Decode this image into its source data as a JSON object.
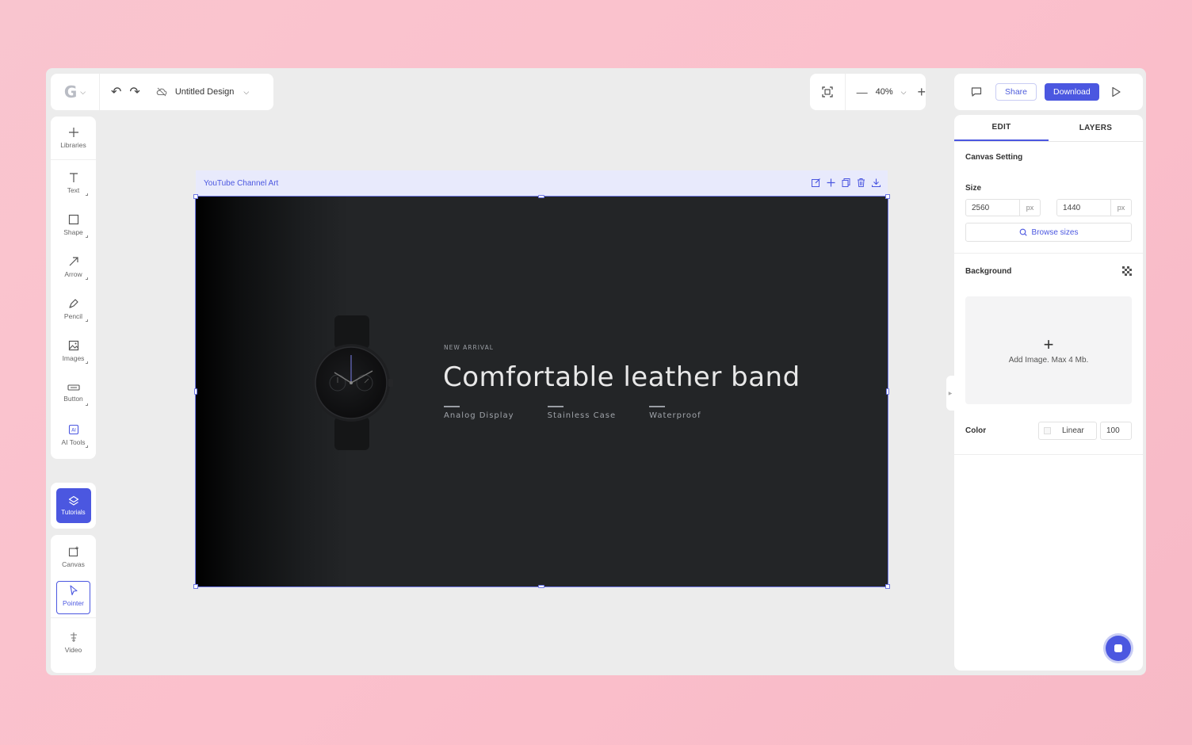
{
  "app": {
    "document_title": "Untitled Design",
    "zoom": "40%"
  },
  "toolbar_right": {
    "share_label": "Share",
    "download_label": "Download"
  },
  "left_tools": [
    {
      "label": "Libraries",
      "icon": "plus-icon"
    },
    {
      "label": "Text",
      "icon": "text-icon"
    },
    {
      "label": "Shape",
      "icon": "square-icon"
    },
    {
      "label": "Arrow",
      "icon": "arrow-icon"
    },
    {
      "label": "Pencil",
      "icon": "pencil-icon"
    },
    {
      "label": "Images",
      "icon": "image-icon"
    },
    {
      "label": "Button",
      "icon": "button-icon"
    },
    {
      "label": "AI Tools",
      "icon": "ai-icon"
    }
  ],
  "tutorials_label": "Tutorials",
  "bottom_tools": [
    {
      "label": "Canvas",
      "icon": "canvas-icon"
    },
    {
      "label": "Pointer",
      "icon": "pointer-icon"
    },
    {
      "label": "Video",
      "icon": "video-icon"
    }
  ],
  "frame": {
    "title": "YouTube Channel Art"
  },
  "artboard": {
    "eyebrow": "NEW ARRIVAL",
    "headline": "Comfortable leather band",
    "features": [
      "Analog Display",
      "Stainless Case",
      "Waterproof"
    ]
  },
  "right_panel": {
    "tabs": [
      "EDIT",
      "LAYERS"
    ],
    "canvas_setting_title": "Canvas Setting",
    "size_label": "Size",
    "width_value": "2560",
    "height_value": "1440",
    "unit": "px",
    "browse_label": "Browse sizes",
    "background_title": "Background",
    "dropzone_text": "Add Image. Max 4 Mb.",
    "dropzone_plus": "+",
    "color_label": "Color",
    "gradient_mode": "Linear",
    "opacity_value": "100"
  },
  "colors": {
    "accent": "#4b57e0",
    "artboard_bg": "#232527",
    "page_bg": "#fbc0cc"
  }
}
